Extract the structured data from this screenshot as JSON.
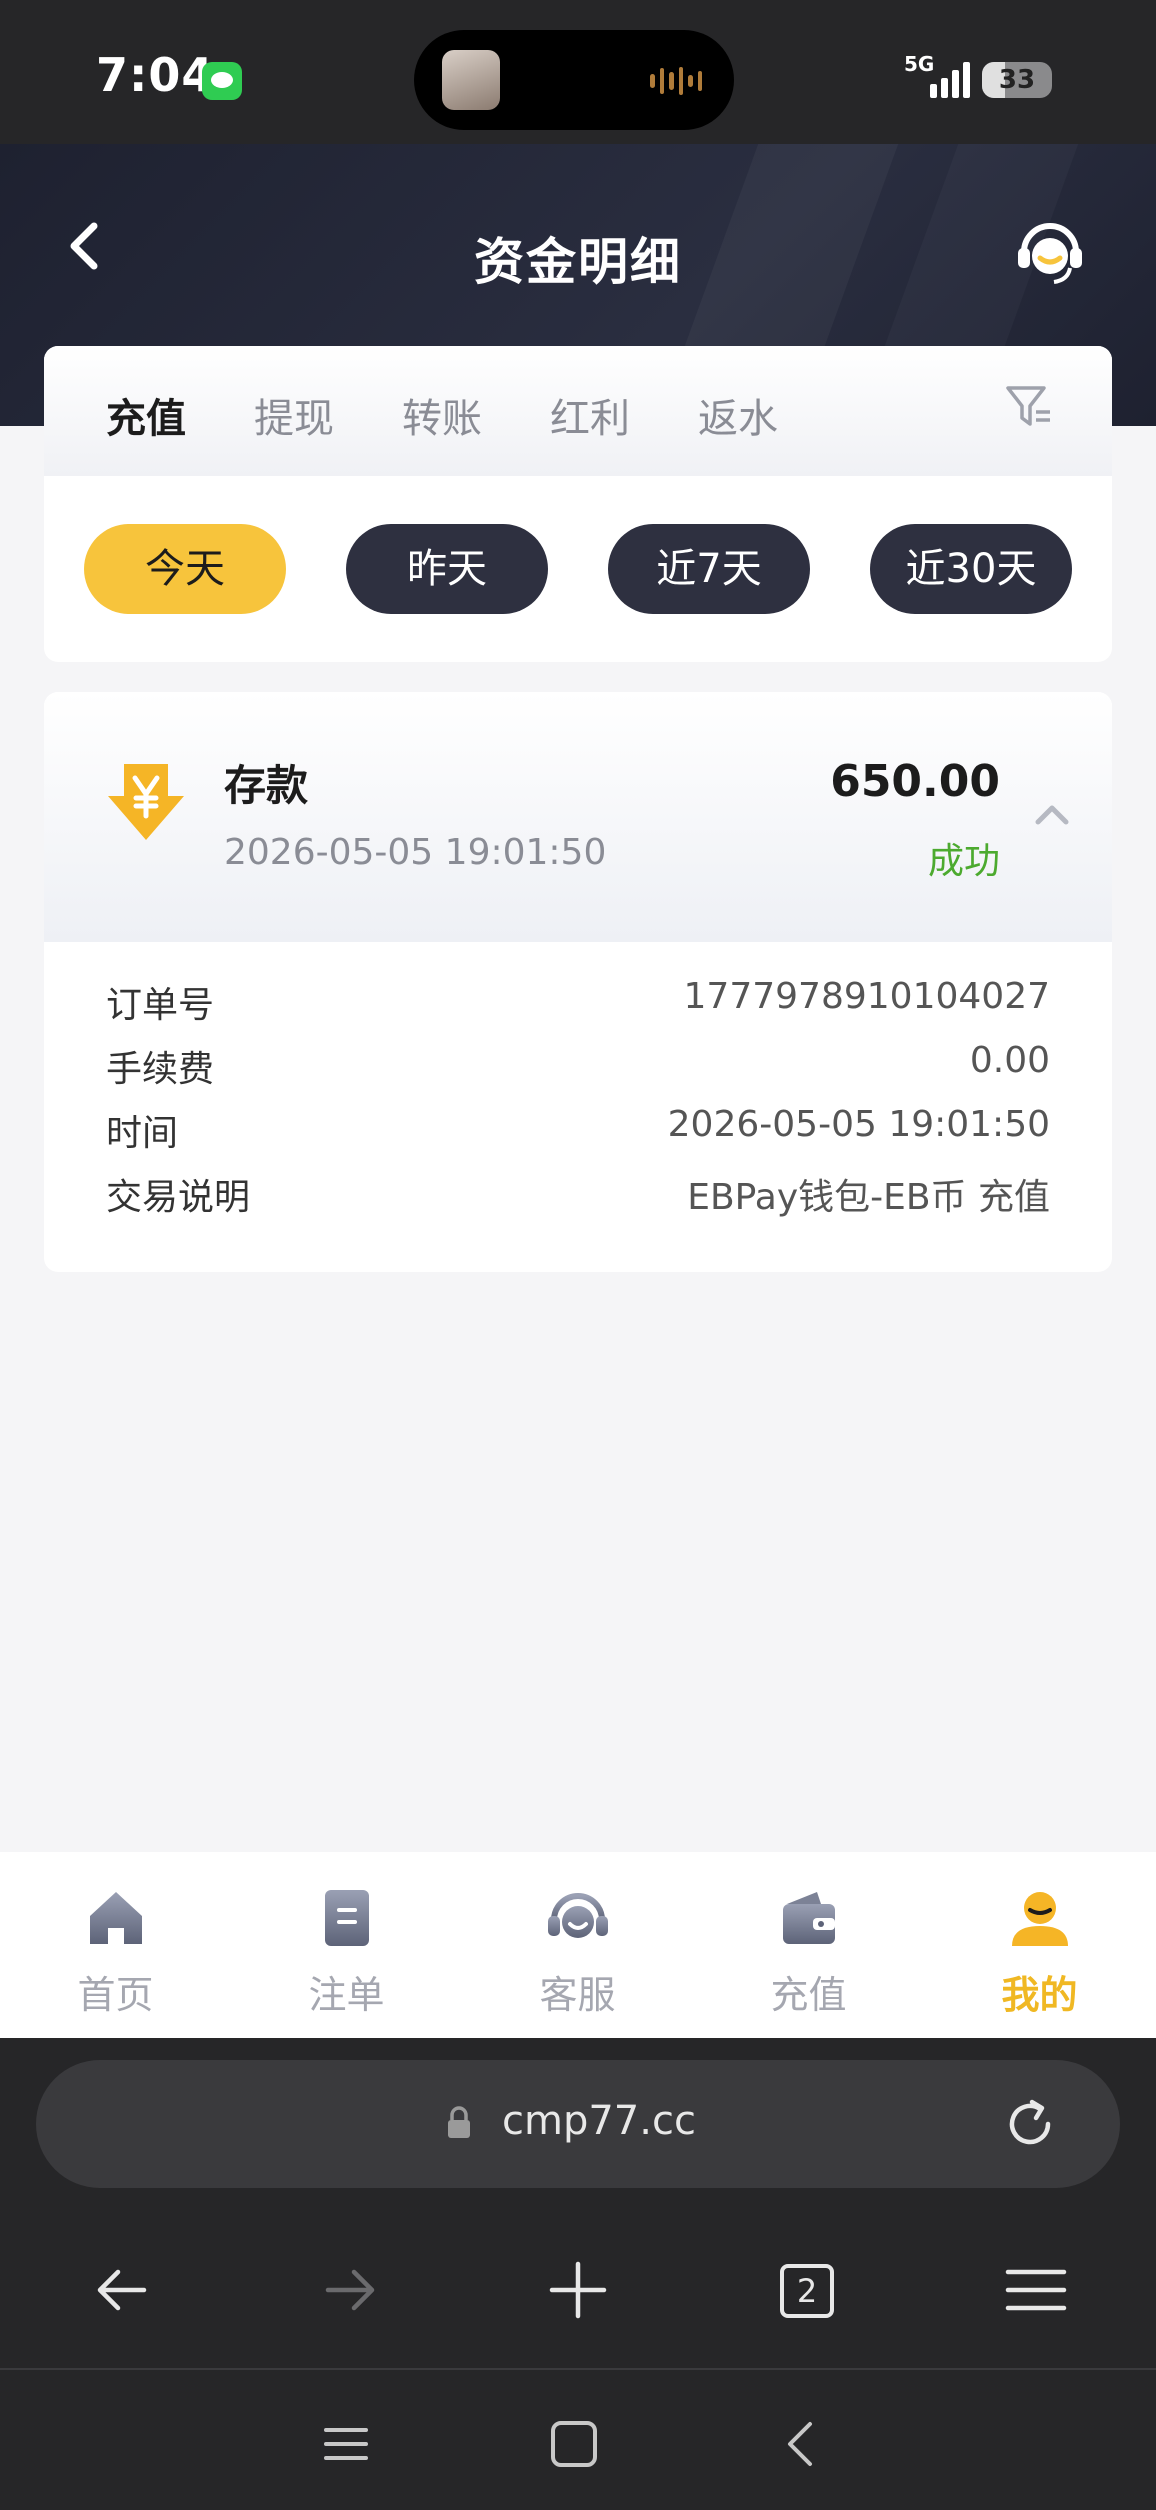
{
  "status_bar": {
    "time": "7:04",
    "network": "5G",
    "battery": "33",
    "battery_level": 0.33
  },
  "header": {
    "title": "资金明细"
  },
  "tabs": [
    {
      "label": "充值",
      "active": true
    },
    {
      "label": "提现",
      "active": false
    },
    {
      "label": "转账",
      "active": false
    },
    {
      "label": "红利",
      "active": false
    },
    {
      "label": "返水",
      "active": false
    }
  ],
  "date_filters": [
    {
      "label": "今天",
      "active": true
    },
    {
      "label": "昨天",
      "active": false
    },
    {
      "label": "近7天",
      "active": false
    },
    {
      "label": "近30天",
      "active": false
    }
  ],
  "record": {
    "title": "存款",
    "time": "2026-05-05 19:01:50",
    "amount": "650.00",
    "status": "成功",
    "icon": "yen-deposit-arrow-icon",
    "details": [
      {
        "label": "订单号",
        "value": "1777978910104027"
      },
      {
        "label": "手续费",
        "value": "0.00"
      },
      {
        "label": "时间",
        "value": "2026-05-05 19:01:50"
      },
      {
        "label": "交易说明",
        "value": "EBPay钱包-EB币 充值"
      }
    ]
  },
  "bottom_nav": [
    {
      "label": "首页",
      "icon": "home-icon",
      "active": false
    },
    {
      "label": "注单",
      "icon": "order-icon",
      "active": false
    },
    {
      "label": "客服",
      "icon": "customer-service-icon",
      "active": false
    },
    {
      "label": "充值",
      "icon": "wallet-icon",
      "active": false
    },
    {
      "label": "我的",
      "icon": "profile-icon",
      "active": true
    }
  ],
  "browser": {
    "url": "cmp77.cc",
    "tab_count": "2"
  },
  "colors": {
    "accent": "#f7c43c",
    "header_bg": "#1e2130",
    "success": "#4caa2f",
    "chip_dark": "#2e3040"
  }
}
